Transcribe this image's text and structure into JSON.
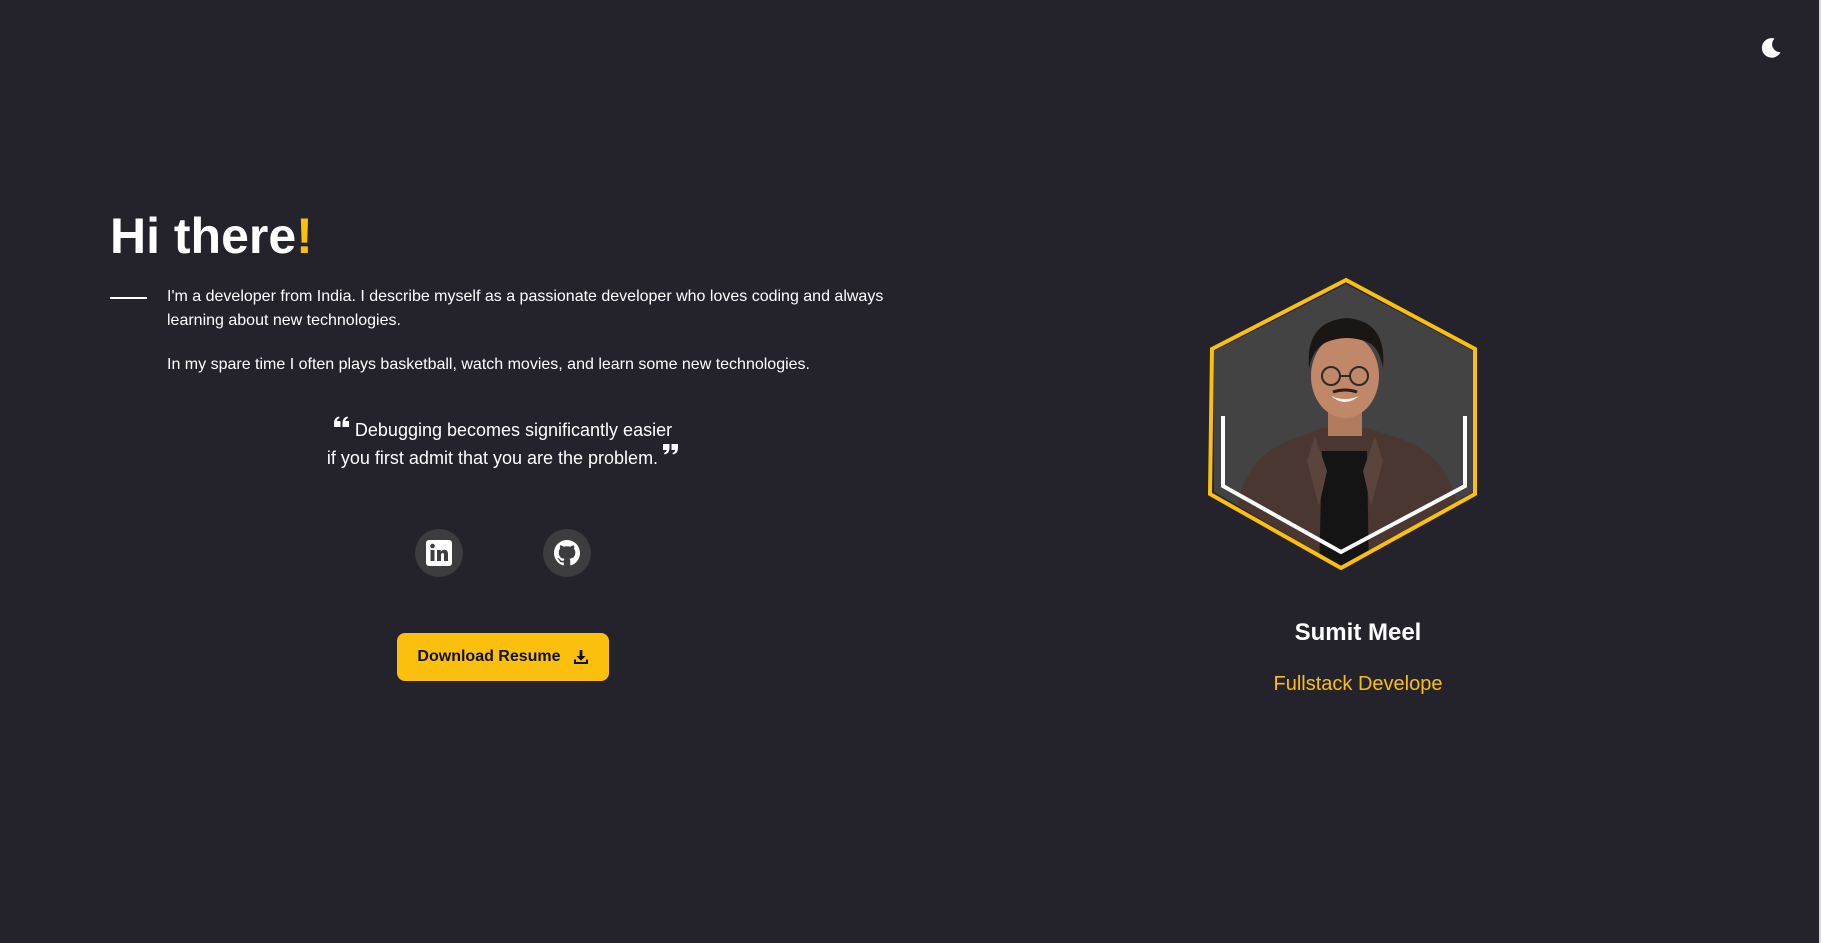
{
  "theme": {
    "toggle_icon": "moon-icon",
    "accent_color": "#fbbf0e",
    "background_color": "#24222b"
  },
  "hero": {
    "greeting": "Hi there",
    "greeting_accent": "!",
    "intro": "I'm a developer from India. I describe myself as a passionate developer who loves coding and always learning about new technologies.",
    "spare_time": "In my spare time I often plays basketball, watch movies, and learn some new technologies.",
    "quote_line1": "Debugging becomes significantly easier",
    "quote_line2": "if you first admit that you are the problem.",
    "quote_open_icon": "quote-left-icon",
    "quote_close_icon": "quote-right-icon"
  },
  "social": [
    {
      "icon": "linkedin-icon"
    },
    {
      "icon": "github-icon"
    }
  ],
  "resume_button": {
    "label": "Download Resume",
    "icon": "download-icon"
  },
  "profile": {
    "name": "Sumit Meel",
    "role": "Fullstack Develope",
    "avatar_icon": "profile-photo"
  }
}
